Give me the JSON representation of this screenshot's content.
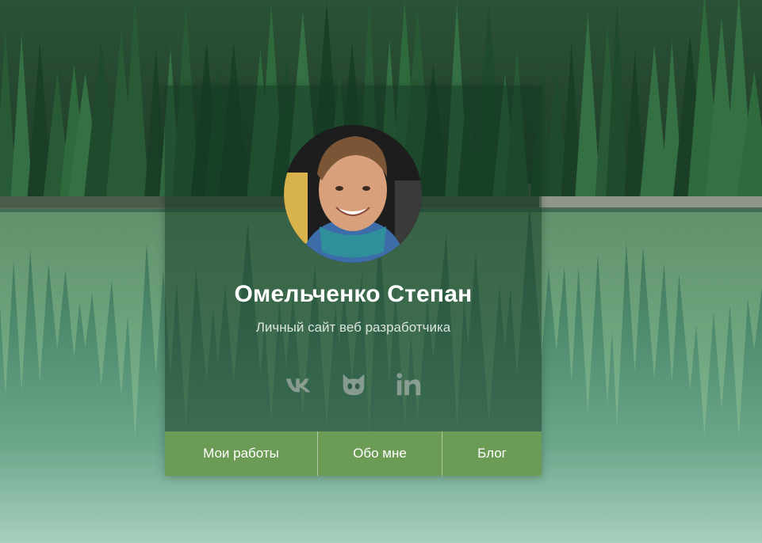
{
  "profile": {
    "name": "Омельченко Степан",
    "subtitle": "Личный сайт веб разработчика"
  },
  "social": [
    {
      "icon": "vk-icon"
    },
    {
      "icon": "github-icon"
    },
    {
      "icon": "linkedin-icon"
    }
  ],
  "nav": {
    "works": "Мои работы",
    "about": "Обо мне",
    "blog": "Блог"
  },
  "colors": {
    "nav_bg": "#6c9b55",
    "card_overlay": "#143723",
    "social_icon": "#bfbfbf"
  }
}
